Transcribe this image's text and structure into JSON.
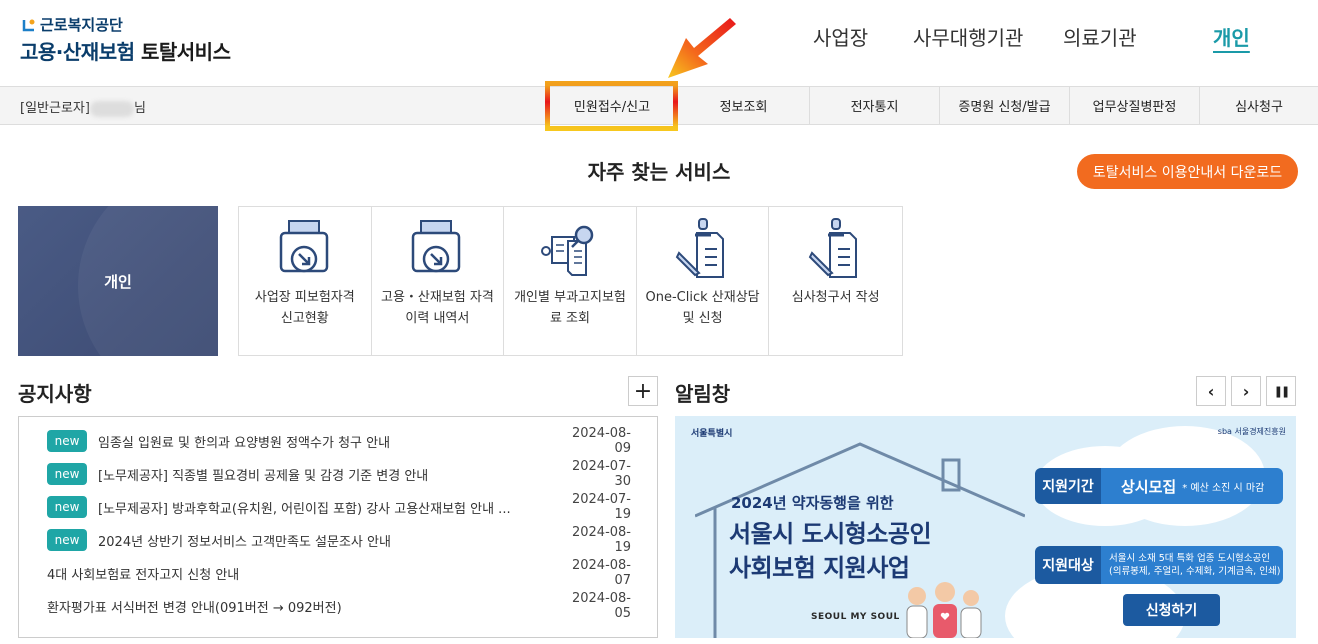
{
  "header": {
    "org_name": "근로복지공단",
    "service_name_highlight": "고용·산재보험",
    "service_name_rest": "토탈서비스",
    "top_nav": [
      {
        "label": "사업장"
      },
      {
        "label": "사무대행기관"
      },
      {
        "label": "의료기관"
      },
      {
        "label": "개인",
        "active": true
      }
    ]
  },
  "gnb": {
    "user_prefix": "[일반근로자]",
    "user_suffix": "님",
    "menu": [
      "민원접수/신고",
      "정보조회",
      "전자통지",
      "증명원 신청/발급",
      "업무상질병판정",
      "심사청구"
    ],
    "highlighted": "민원접수/신고"
  },
  "frequent": {
    "title": "자주 찾는 서비스",
    "download_label": "토탈서비스 이용안내서 다운로드",
    "user_type": "개인",
    "items": [
      {
        "label": "사업장 피보험자격 신고현황",
        "icon": "tray-download-icon"
      },
      {
        "label": "고용・산재보험 자격 이력 내역서",
        "icon": "tray-download-icon"
      },
      {
        "label": "개인별 부과고지보험료 조회",
        "icon": "document-search-icon"
      },
      {
        "label": "One-Click 산재상담 및 신청",
        "icon": "pen-document-icon"
      },
      {
        "label": "심사청구서 작성",
        "icon": "pen-document-icon"
      }
    ]
  },
  "notice": {
    "title": "공지사항",
    "more_label": "+",
    "new_label": "new",
    "rows": [
      {
        "text": "임종실 입원료 및 한의과 요양병원 정액수가 청구 안내",
        "date": "2024-08-09",
        "new": true
      },
      {
        "text": "[노무제공자] 직종별 필요경비 공제율 및 감경 기준 변경 안내",
        "date": "2024-07-30",
        "new": true
      },
      {
        "text": "[노무제공자] 방과후학교(유치원, 어린이집 포함) 강사 고용산재보험 안내 ...",
        "date": "2024-07-19",
        "new": true
      },
      {
        "text": "2024년 상반기 정보서비스 고객만족도 설문조사 안내",
        "date": "2024-08-19",
        "new": true
      },
      {
        "text": "4대 사회보험료 전자고지 신청 안내",
        "date": "2024-08-07",
        "new": false
      },
      {
        "text": "환자평가표 서식버전 변경 안내(091버전 → 092버전)",
        "date": "2024-08-05",
        "new": false
      }
    ]
  },
  "alarm": {
    "title": "알림창",
    "prev_label": "‹",
    "next_label": "›",
    "pause_label": "❚❚",
    "banner": {
      "seoul_logo": "서울특별시",
      "sba_logo": "sba 서울경제진흥원",
      "subtitle": "2024년 약자동행을 위한",
      "title_line1": "서울시 도시형소공인",
      "title_line2": "사회보험 지원사업",
      "slogan": "SEOUL MY SOUL",
      "period_label": "지원기간",
      "period_value": "상시모집",
      "period_note": "* 예산 소진 시 마감",
      "target_label": "지원대상",
      "target_value1": "서울시 소재 5대 특화 업종 도시형소공인",
      "target_value2": "(의류봉제, 주얼리, 수제화, 기계금속, 인쇄)",
      "apply_label": "신청하기"
    }
  },
  "colors": {
    "brand_navy": "#0a3d6b",
    "teal": "#1a9aa8",
    "orange": "#f26b1f",
    "new_badge": "#1fa6a6"
  }
}
